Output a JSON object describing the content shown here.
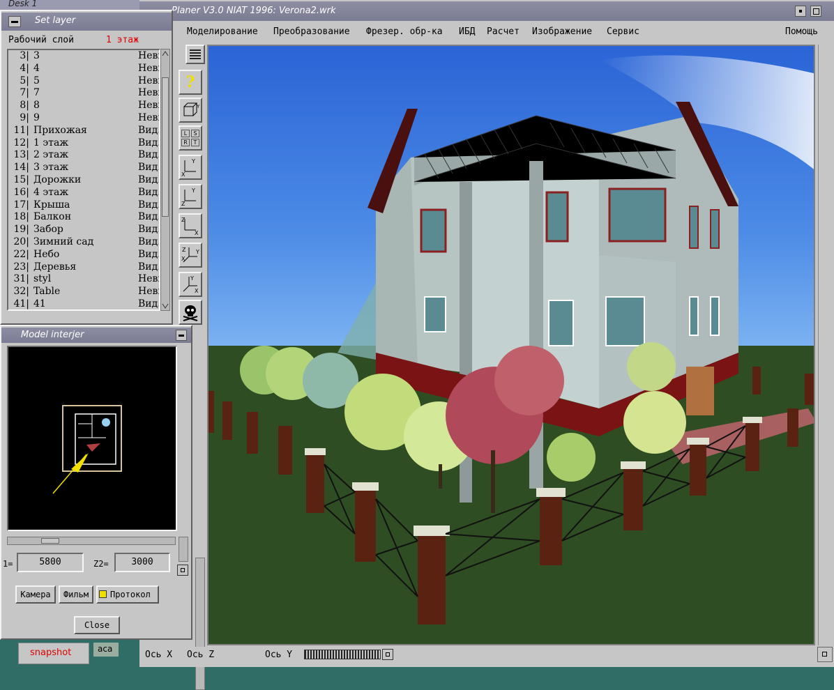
{
  "desktop": {
    "desk_label": "Desk 1",
    "snapshot_label": "snapshot",
    "aca_label": "aca"
  },
  "main_window": {
    "title": "Planer V3.0 NIAT 1996: Verona2.wrk",
    "menu": [
      "Моделирование",
      "Преобразование",
      "Фрезер. обр-ка",
      "ИБД",
      "Расчет",
      "Изображение",
      "Сервис"
    ],
    "help": "Помощь",
    "status": {
      "axis_x": "Ось X",
      "axis_z": "Ось Z",
      "axis_y": "Ось Y"
    },
    "help_glyph": "?"
  },
  "set_layer": {
    "title": "Set layer",
    "working_layer_label": "Рабочий слой",
    "working_layer_value": "1 этаж",
    "rows": [
      {
        "num": "3|",
        "name": "3",
        "state": "Неви"
      },
      {
        "num": "4|",
        "name": "4",
        "state": "Неви"
      },
      {
        "num": "5|",
        "name": "5",
        "state": "Неви"
      },
      {
        "num": "7|",
        "name": "7",
        "state": "Неви"
      },
      {
        "num": "8|",
        "name": "8",
        "state": "Неви"
      },
      {
        "num": "9|",
        "name": "9",
        "state": "Неви"
      },
      {
        "num": "11|",
        "name": "Прихожая",
        "state": "Вид."
      },
      {
        "num": "12|",
        "name": "1 этаж",
        "state": "Вид."
      },
      {
        "num": "13|",
        "name": "2 этаж",
        "state": "Вид."
      },
      {
        "num": "14|",
        "name": "3 этаж",
        "state": "Вид."
      },
      {
        "num": "15|",
        "name": "Дорожки",
        "state": "Вид."
      },
      {
        "num": "16|",
        "name": "4 этаж",
        "state": "Вид."
      },
      {
        "num": "17|",
        "name": "Крыша",
        "state": "Вид."
      },
      {
        "num": "18|",
        "name": "Балкон",
        "state": "Вид."
      },
      {
        "num": "19|",
        "name": "Забор",
        "state": "Вид."
      },
      {
        "num": "20|",
        "name": "Зимний сад",
        "state": "Вид."
      },
      {
        "num": "22|",
        "name": "Небо",
        "state": "Вид."
      },
      {
        "num": "23|",
        "name": "Деревья",
        "state": "Вид."
      },
      {
        "num": "31|",
        "name": "styl",
        "state": "Неви"
      },
      {
        "num": "32|",
        "name": "Table",
        "state": "Неви"
      },
      {
        "num": "41|",
        "name": "41",
        "state": "Вид."
      }
    ]
  },
  "model_interjer": {
    "title": "Model interjer",
    "z1_label": "1=",
    "z1_value": "5800",
    "z2_label": "Z2=",
    "z2_value": "3000",
    "camera_button": "Камера",
    "film_button": "Фильм",
    "protocol_label": "Протокол",
    "close_button": "Close"
  },
  "toolbar": {
    "labels": {
      "x": "X",
      "y": "Y",
      "z": "Z",
      "l": "L",
      "s": "S",
      "r": "R",
      "t": "T"
    }
  },
  "colors": {
    "accent_red": "#e00000",
    "title_bar": "#8485a0",
    "window_gray": "#c6c6c6"
  }
}
